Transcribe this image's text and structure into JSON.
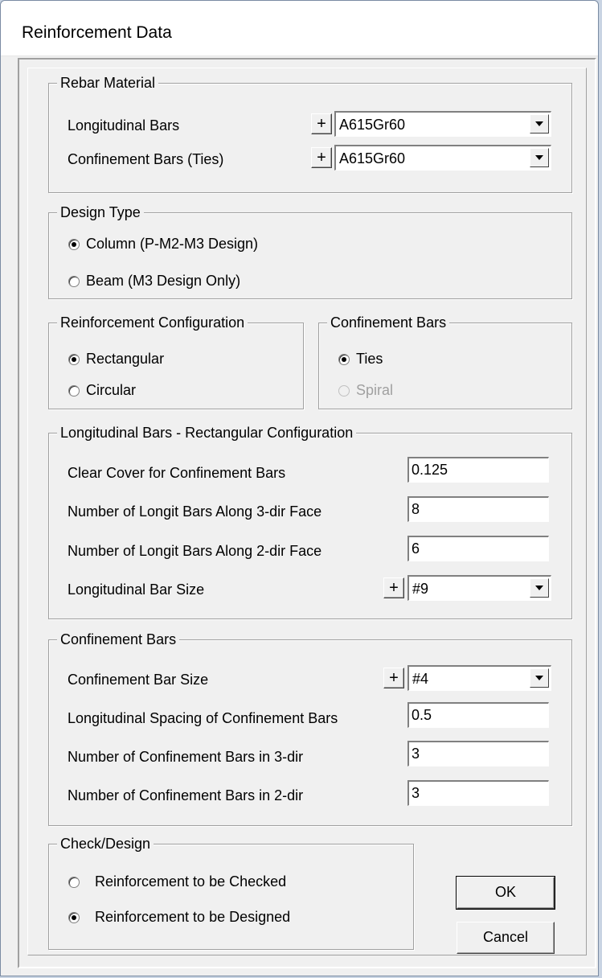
{
  "window": {
    "title": "Reinforcement Data"
  },
  "rebar_material": {
    "legend": "Rebar Material",
    "longitudinal_label": "Longitudinal Bars",
    "longitudinal_value": "A615Gr60",
    "confinement_label": "Confinement Bars  (Ties)",
    "confinement_value": "A615Gr60",
    "plus": "+"
  },
  "design_type": {
    "legend": "Design Type",
    "options": [
      "Column  (P-M2-M3 Design)",
      "Beam  (M3 Design Only)"
    ],
    "selected": "Column  (P-M2-M3 Design)"
  },
  "reinforcement_configuration": {
    "legend": "Reinforcement Configuration",
    "options": [
      "Rectangular",
      "Circular"
    ],
    "selected": "Rectangular"
  },
  "confinement_type": {
    "legend": "Confinement Bars",
    "options": [
      "Ties",
      "Spiral"
    ],
    "selected": "Ties",
    "disabled": [
      "Spiral"
    ]
  },
  "longitudinal_bars": {
    "legend": "Longitudinal Bars - Rectangular Configuration",
    "clear_cover_label": "Clear Cover for Confinement Bars",
    "clear_cover_value": "0.125",
    "bars_3dir_label": "Number of Longit Bars Along 3-dir Face",
    "bars_3dir_value": "8",
    "bars_2dir_label": "Number of Longit Bars Along 2-dir Face",
    "bars_2dir_value": "6",
    "bar_size_label": "Longitudinal Bar Size",
    "bar_size_value": "#9"
  },
  "confinement_bars": {
    "legend": "Confinement Bars",
    "bar_size_label": "Confinement Bar Size",
    "bar_size_value": "#4",
    "spacing_label": "Longitudinal Spacing of Confinement Bars",
    "spacing_value": "0.5",
    "count_3dir_label": "Number of Confinement Bars in 3-dir",
    "count_3dir_value": "3",
    "count_2dir_label": "Number of Confinement Bars in 2-dir",
    "count_2dir_value": "3"
  },
  "check_design": {
    "legend": "Check/Design",
    "options": [
      "Reinforcement to be Checked",
      "Reinforcement to be Designed"
    ],
    "selected": "Reinforcement to be Designed"
  },
  "buttons": {
    "ok": "OK",
    "cancel": "Cancel"
  }
}
